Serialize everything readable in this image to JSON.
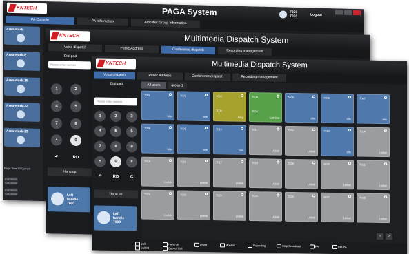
{
  "brand": {
    "logo_text": "KNTECH",
    "logo_color": "#cf1f25"
  },
  "colors": {
    "idle": "#4f79ad",
    "ringing": "#a7a12d",
    "call_out": "#58a14b",
    "unlink": "#9a9ca0",
    "tab_active": "#3f6aa8"
  },
  "paga": {
    "title": "PAGA System",
    "user_line1": "7020",
    "user_line2": "7020",
    "logout": "Logout",
    "tabs": [
      "PA Console",
      "PA Information",
      "Amplifier Group Information"
    ],
    "areas": [
      "Area-work-",
      "Area-work-8",
      "Area-work-15",
      "Area-work-22",
      "Area-work-23"
    ],
    "bottom_label": "Page Size 40  Current",
    "bottom_rows": [
      "0x1E8500\n0x1E8500",
      "0x1E8500\n0x1E8500"
    ]
  },
  "mid": {
    "title": "Multimedia Dispatch System",
    "tabs": [
      "Voice dispatch",
      "Public Address",
      "Conference dispatch",
      "Recording management"
    ],
    "dialpad_title": "Dial pad",
    "input_placeholder": "Please enter number",
    "keys": [
      "1",
      "2",
      "4",
      "5",
      "7",
      "8",
      "•",
      "0",
      "↶",
      "RD"
    ],
    "hangup": "Hang up",
    "handle_line1": "Left",
    "handle_line2": "handle",
    "handle_line3": "7000"
  },
  "front": {
    "title": "Multimedia Dispatch System",
    "tabs": [
      "Voice dispatch",
      "Public Address",
      "Conference dispatch",
      "Recording management"
    ],
    "dialpad_title": "Dial pad",
    "input_placeholder": "Please enter number",
    "keys": [
      "1",
      "2",
      "3",
      "4",
      "5",
      "6",
      "7",
      "8",
      "9",
      "•",
      "0",
      "#",
      "↶",
      "RD",
      "C"
    ],
    "hangup": "Hang up",
    "handle_line1": "Left",
    "handle_line2": "handle",
    "handle_line3": "7000",
    "group_tabs": [
      "All users",
      "group-1"
    ],
    "tiles": [
      {
        "num": "7001",
        "num2": "",
        "status": "Idle",
        "state": "idle"
      },
      {
        "num": "7002",
        "num2": "",
        "status": "Idle",
        "state": "idle"
      },
      {
        "num": "7003",
        "num2": "7004",
        "status": "Ring",
        "state": "ringing"
      },
      {
        "num": "7004",
        "num2": "7003",
        "status": "Call Out",
        "state": "call_out"
      },
      {
        "num": "7005",
        "num2": "",
        "status": "Idle",
        "state": "idle"
      },
      {
        "num": "7006",
        "num2": "",
        "status": "Idle",
        "state": "idle"
      },
      {
        "num": "7007",
        "num2": "",
        "status": "Idle",
        "state": "idle"
      },
      {
        "num": "7008",
        "num2": "",
        "status": "Idle",
        "state": "idle"
      },
      {
        "num": "7009",
        "num2": "",
        "status": "Idle",
        "state": "idle"
      },
      {
        "num": "7010",
        "num2": "",
        "status": "Idle",
        "state": "idle"
      },
      {
        "num": "7011",
        "num2": "",
        "status": "Unlink",
        "state": "unlink"
      },
      {
        "num": "7012",
        "num2": "",
        "status": "Unlink",
        "state": "unlink"
      },
      {
        "num": "7013",
        "num2": "",
        "status": "Idle",
        "state": "idle"
      },
      {
        "num": "7014",
        "num2": "",
        "status": "Unlink",
        "state": "unlink"
      },
      {
        "num": "7015",
        "num2": "",
        "status": "Unlink",
        "state": "unlink"
      },
      {
        "num": "7016",
        "num2": "",
        "status": "Unlink",
        "state": "unlink"
      },
      {
        "num": "7017",
        "num2": "",
        "status": "Unlink",
        "state": "unlink"
      },
      {
        "num": "7018",
        "num2": "",
        "status": "Unlink",
        "state": "unlink"
      },
      {
        "num": "7019",
        "num2": "",
        "status": "Unlink",
        "state": "unlink"
      },
      {
        "num": "7020",
        "num2": "",
        "status": "Unlink",
        "state": "unlink"
      },
      {
        "num": "7021",
        "num2": "",
        "status": "Unlink",
        "state": "unlink"
      },
      {
        "num": "7022",
        "num2": "",
        "status": "Unlink",
        "state": "unlink"
      },
      {
        "num": "7023",
        "num2": "",
        "status": "Unlink",
        "state": "unlink"
      },
      {
        "num": "7024",
        "num2": "",
        "status": "Unlink",
        "state": "unlink"
      },
      {
        "num": "7025",
        "num2": "",
        "status": "Unlink",
        "state": "unlink"
      },
      {
        "num": "7026",
        "num2": "",
        "status": "Unlink",
        "state": "unlink"
      },
      {
        "num": "7027",
        "num2": "",
        "status": "Unlink",
        "state": "unlink"
      },
      {
        "num": "7028",
        "num2": "",
        "status": "Unlink",
        "state": "unlink"
      }
    ],
    "bottom_actions": [
      {
        "label": "Call",
        "icon": "phone-icon"
      },
      {
        "label": "Hang up",
        "icon": "hangup-icon"
      },
      {
        "label": "Insert",
        "icon": "insert-icon"
      },
      {
        "label": "Monitor",
        "icon": "monitor-icon"
      },
      {
        "label": "Recording",
        "icon": "record-icon"
      },
      {
        "label": "Stop Broadcast",
        "icon": "stop-icon"
      },
      {
        "label": "PA",
        "icon": "pa-icon"
      },
      {
        "label": "File PA",
        "icon": "file-pa-icon"
      },
      {
        "label": "Call All",
        "icon": "call-all-icon"
      },
      {
        "label": "Cancel Call",
        "icon": "cancel-call-icon"
      }
    ]
  }
}
